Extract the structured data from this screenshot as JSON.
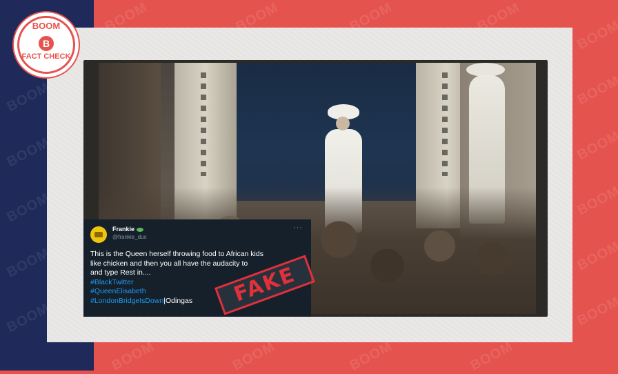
{
  "brand": {
    "logo_top": "BOOM",
    "logo_mark": "B",
    "logo_bottom": "FACT CHECK",
    "watermark": "BOOM",
    "accent": "#e5534e",
    "navy": "#1f2a5a"
  },
  "tweet": {
    "name": "Frankie",
    "handle": "@frankie_dux",
    "more": "···",
    "line1": "This is the Queen herself throwing food to African kids",
    "line2": "like chicken and then you all have the audacity to",
    "line3": "and type Rest in....",
    "tag1": "#BlackTwitter",
    "tag2": "#QueenElisabeth",
    "tag3": "#LondonBridgeIsDown",
    "tag3_suffix": "|Odingas"
  },
  "stamp": {
    "label": "FAKE",
    "color": "#e0303a"
  }
}
